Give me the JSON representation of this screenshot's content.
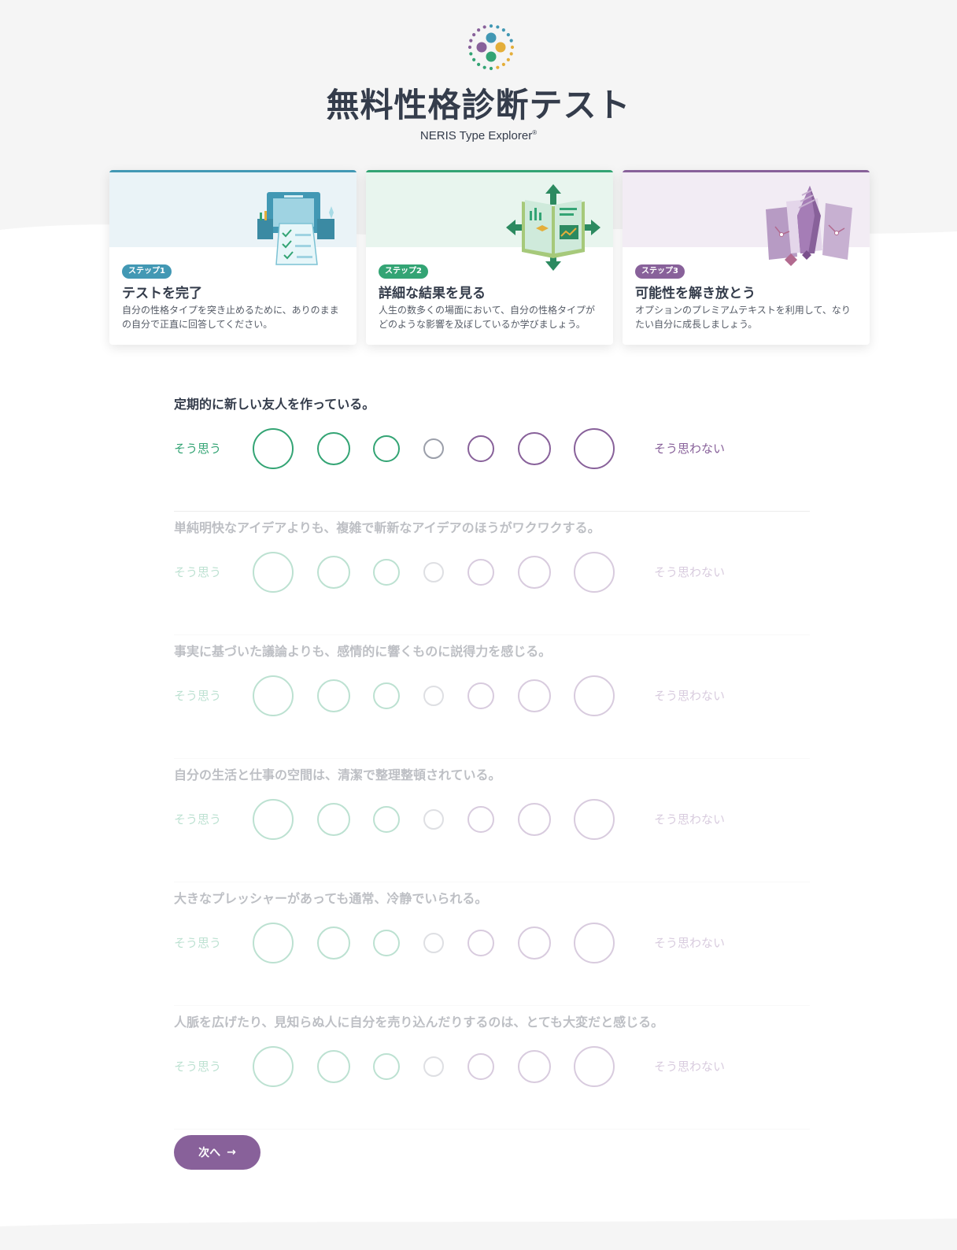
{
  "header": {
    "title": "無料性格診断テスト",
    "subtitle": "NERIS Type Explorer",
    "trademark": "®"
  },
  "steps": [
    {
      "badge": "ステップ1",
      "title": "テストを完了",
      "desc": "自分の性格タイプを突き止めるために、ありのままの自分で正直に回答してください。",
      "color": "#4298b4",
      "bg": "#eaf3f7"
    },
    {
      "badge": "ステップ2",
      "title": "詳細な結果を見る",
      "desc": "人生の数多くの場面において、自分の性格タイプがどのような影響を及ぼしているか学びましょう。",
      "color": "#33a474",
      "bg": "#e8f5ee"
    },
    {
      "badge": "ステップ3",
      "title": "可能性を解き放とう",
      "desc": "オプションのプレミアムテキストを利用して、なりたい自分に成長しましょう。",
      "color": "#88619a",
      "bg": "#f2ecf4"
    }
  ],
  "scale": {
    "agree": "そう思う",
    "disagree": "そう思わない",
    "agree_color": "#33a474",
    "neutral_color": "#9b9faa",
    "disagree_color": "#88619a"
  },
  "questions": [
    {
      "text": "定期的に新しい友人を作っている。",
      "active": true
    },
    {
      "text": "単純明快なアイデアよりも、複雑で斬新なアイデアのほうがワクワクする。",
      "active": false
    },
    {
      "text": "事実に基づいた議論よりも、感情的に響くものに説得力を感じる。",
      "active": false
    },
    {
      "text": "自分の生活と仕事の空間は、清潔で整理整頓されている。",
      "active": false
    },
    {
      "text": "大きなプレッシャーがあっても通常、冷静でいられる。",
      "active": false
    },
    {
      "text": "人脈を広げたり、見知らぬ人に自分を売り込んだりするのは、とても大変だと感じる。",
      "active": false
    }
  ],
  "next_button": {
    "label": "次へ",
    "arrow": "→",
    "color": "#88619a"
  }
}
